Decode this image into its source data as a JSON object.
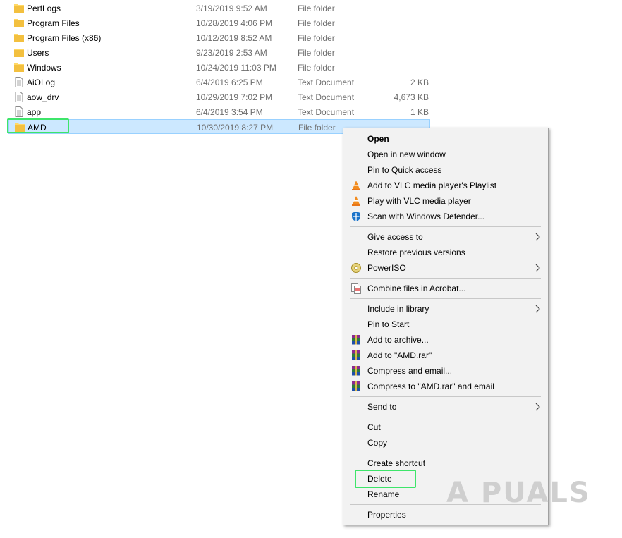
{
  "files": [
    {
      "name": "PerfLogs",
      "date": "3/19/2019 9:52 AM",
      "type": "File folder",
      "size": "",
      "icon": "folder-icon"
    },
    {
      "name": "Program Files",
      "date": "10/28/2019 4:06 PM",
      "type": "File folder",
      "size": "",
      "icon": "folder-icon"
    },
    {
      "name": "Program Files (x86)",
      "date": "10/12/2019 8:52 AM",
      "type": "File folder",
      "size": "",
      "icon": "folder-icon"
    },
    {
      "name": "Users",
      "date": "9/23/2019 2:53 AM",
      "type": "File folder",
      "size": "",
      "icon": "folder-icon"
    },
    {
      "name": "Windows",
      "date": "10/24/2019 11:03 PM",
      "type": "File folder",
      "size": "",
      "icon": "folder-icon"
    },
    {
      "name": "AiOLog",
      "date": "6/4/2019 6:25 PM",
      "type": "Text Document",
      "size": "2 KB",
      "icon": "text-document-icon"
    },
    {
      "name": "aow_drv",
      "date": "10/29/2019 7:02 PM",
      "type": "Text Document",
      "size": "4,673 KB",
      "icon": "text-document-icon"
    },
    {
      "name": "app",
      "date": "6/4/2019 3:54 PM",
      "type": "Text Document",
      "size": "1 KB",
      "icon": "text-document-icon"
    },
    {
      "name": "AMD",
      "date": "10/30/2019 8:27 PM",
      "type": "File folder",
      "size": "",
      "icon": "folder-icon",
      "selected": true
    }
  ],
  "context_menu": {
    "items": [
      {
        "label": "Open",
        "bold": true
      },
      {
        "label": "Open in new window"
      },
      {
        "label": "Pin to Quick access"
      },
      {
        "label": "Add to VLC media player's Playlist",
        "icon": "vlc-icon"
      },
      {
        "label": "Play with VLC media player",
        "icon": "vlc-icon"
      },
      {
        "label": "Scan with Windows Defender...",
        "icon": "windows-defender-icon"
      },
      {
        "label": "Give access to",
        "submenu": true
      },
      {
        "label": "Restore previous versions"
      },
      {
        "label": "PowerISO",
        "icon": "poweriso-icon",
        "submenu": true
      },
      {
        "label": "Combine files in Acrobat...",
        "icon": "acrobat-icon"
      },
      {
        "label": "Include in library",
        "submenu": true
      },
      {
        "label": "Pin to Start"
      },
      {
        "label": "Add to archive...",
        "icon": "winrar-icon"
      },
      {
        "label": "Add to \"AMD.rar\"",
        "icon": "winrar-icon"
      },
      {
        "label": "Compress and email...",
        "icon": "winrar-icon"
      },
      {
        "label": "Compress to \"AMD.rar\" and email",
        "icon": "winrar-icon"
      },
      {
        "label": "Send to",
        "submenu": true
      },
      {
        "label": "Cut"
      },
      {
        "label": "Copy"
      },
      {
        "label": "Create shortcut"
      },
      {
        "label": "Delete",
        "highlighted": true
      },
      {
        "label": "Rename"
      },
      {
        "label": "Properties"
      }
    ]
  },
  "watermark": {
    "text": "A  PUALS"
  },
  "colors": {
    "selection_bg": "#cce8ff",
    "highlight_border": "#3ee56a",
    "menu_bg": "#f2f2f2"
  }
}
